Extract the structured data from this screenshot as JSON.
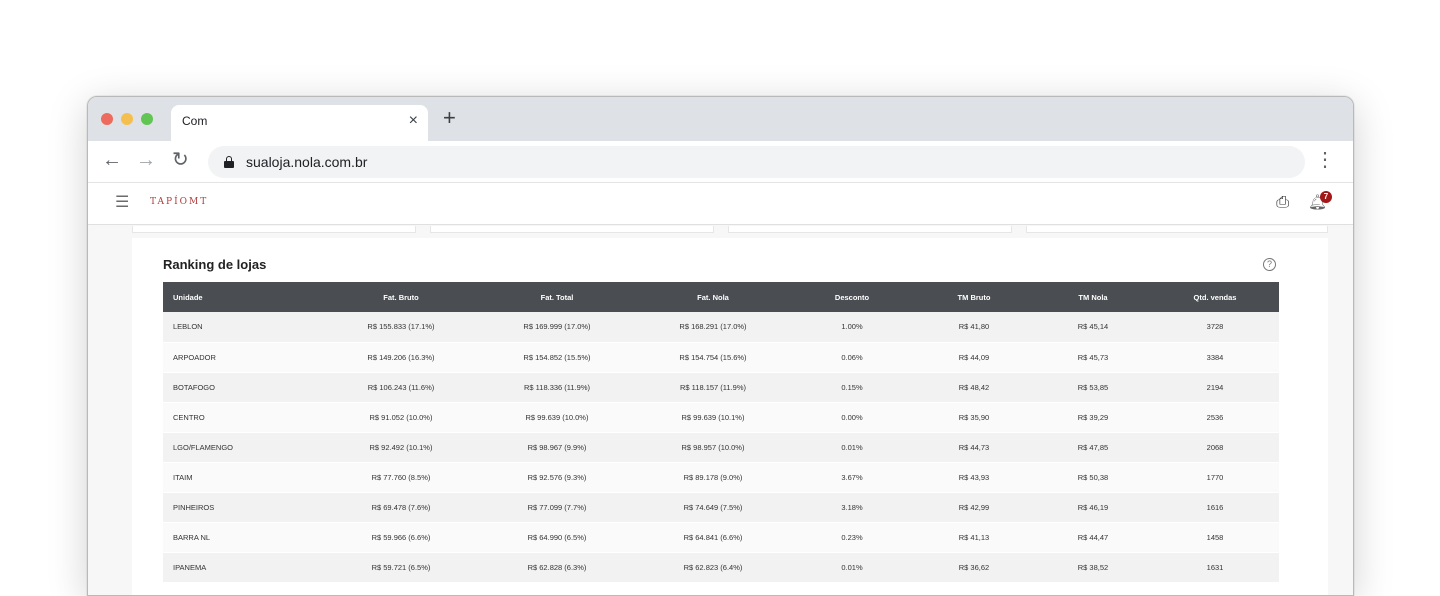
{
  "browser": {
    "tab_title": "Com",
    "tab_close": "×",
    "new_tab": "+",
    "url": "sualoja.nola.com.br"
  },
  "app": {
    "logo_text": "TAPÍOMT",
    "notification_count": "7"
  },
  "ranking": {
    "title": "Ranking de lojas",
    "help_glyph": "?",
    "columns": [
      "Unidade",
      "Fat. Bruto",
      "Fat. Total",
      "Fat. Nola",
      "Desconto",
      "TM Bruto",
      "TM Nola",
      "Qtd. vendas"
    ],
    "rows": [
      [
        "LEBLON",
        "R$ 155.833 (17.1%)",
        "R$ 169.999 (17.0%)",
        "R$ 168.291 (17.0%)",
        "1.00%",
        "R$ 41,80",
        "R$ 45,14",
        "3728"
      ],
      [
        "ARPOADOR",
        "R$ 149.206 (16.3%)",
        "R$ 154.852 (15.5%)",
        "R$ 154.754 (15.6%)",
        "0.06%",
        "R$ 44,09",
        "R$ 45,73",
        "3384"
      ],
      [
        "BOTAFOGO",
        "R$ 106.243 (11.6%)",
        "R$ 118.336 (11.9%)",
        "R$ 118.157 (11.9%)",
        "0.15%",
        "R$ 48,42",
        "R$ 53,85",
        "2194"
      ],
      [
        "CENTRO",
        "R$ 91.052 (10.0%)",
        "R$ 99.639 (10.0%)",
        "R$ 99.639 (10.1%)",
        "0.00%",
        "R$ 35,90",
        "R$ 39,29",
        "2536"
      ],
      [
        "LGO/FLAMENGO",
        "R$ 92.492 (10.1%)",
        "R$ 98.967 (9.9%)",
        "R$ 98.957 (10.0%)",
        "0.01%",
        "R$ 44,73",
        "R$ 47,85",
        "2068"
      ],
      [
        "ITAIM",
        "R$ 77.760 (8.5%)",
        "R$ 92.576 (9.3%)",
        "R$ 89.178 (9.0%)",
        "3.67%",
        "R$ 43,93",
        "R$ 50,38",
        "1770"
      ],
      [
        "PINHEIROS",
        "R$ 69.478 (7.6%)",
        "R$ 77.099 (7.7%)",
        "R$ 74.649 (7.5%)",
        "3.18%",
        "R$ 42,99",
        "R$ 46,19",
        "1616"
      ],
      [
        "BARRA NL",
        "R$ 59.966 (6.6%)",
        "R$ 64.990 (6.5%)",
        "R$ 64.841 (6.6%)",
        "0.23%",
        "R$ 41,13",
        "R$ 44,47",
        "1458"
      ],
      [
        "IPANEMA",
        "R$ 59.721 (6.5%)",
        "R$ 62.828 (6.3%)",
        "R$ 62.823 (6.4%)",
        "0.01%",
        "R$ 36,62",
        "R$ 38,52",
        "1631"
      ]
    ]
  }
}
